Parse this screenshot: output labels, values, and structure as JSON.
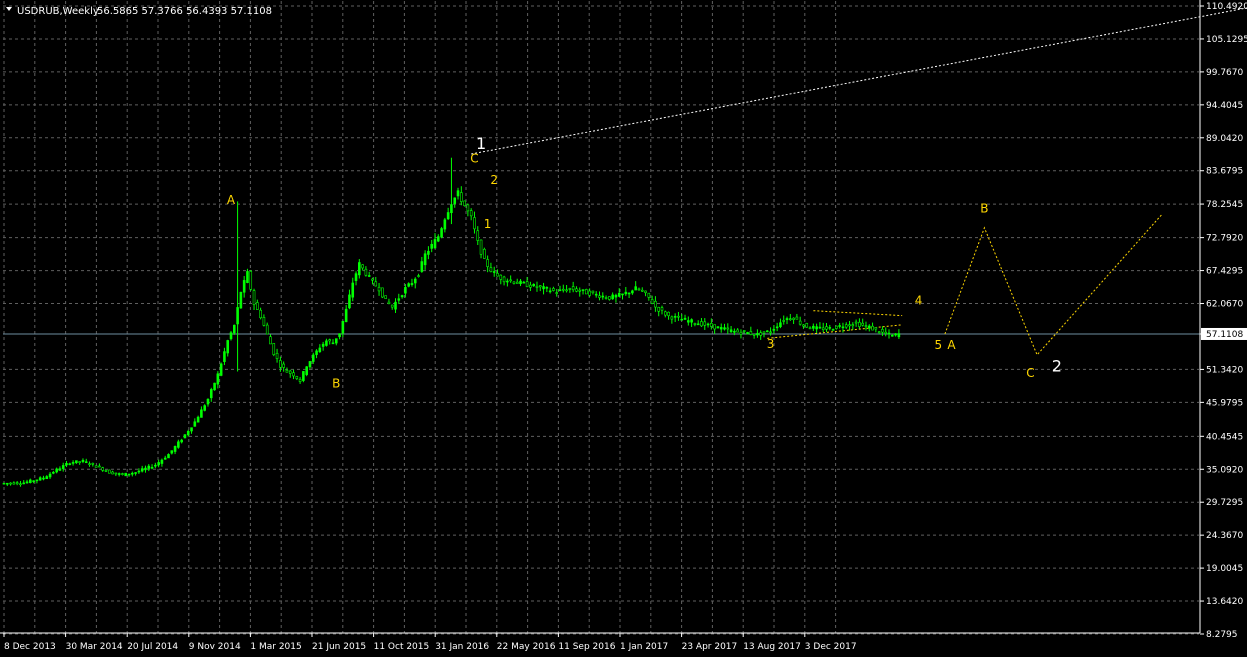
{
  "header": {
    "symbol": "USDRUB,Weekly",
    "ohlc": "56.5865 57.3766 56.4393 57.1108"
  },
  "colors": {
    "background": "#000000",
    "grid": "#5f5f5f",
    "bull_candle": "#00ff00",
    "bear_candle": "#ffffff",
    "price_line": "#6e8ea0",
    "wave_labels": "#ffd700",
    "projection": "#ffd700",
    "trend_line": "#ffffff"
  },
  "chart_data": {
    "type": "candlestick",
    "symbol": "USDRUB",
    "timeframe": "Weekly",
    "ylim": [
      8.2795,
      110.492
    ],
    "y_ticks": [
      "110.4920",
      "105.1295",
      "99.7670",
      "94.4045",
      "89.0420",
      "83.6795",
      "78.2545",
      "72.7920",
      "67.4295",
      "62.0670",
      "57.1108",
      "51.3420",
      "45.9795",
      "40.4545",
      "35.0920",
      "29.7295",
      "24.3670",
      "19.0045",
      "13.6420",
      "8.2795"
    ],
    "current_price": 57.1108,
    "x_ticks": [
      "8 Dec 2013",
      "30 Mar 2014",
      "20 Jul 2014",
      "9 Nov 2014",
      "1 Mar 2015",
      "21 Jun 2015",
      "11 Oct 2015",
      "31 Jan 2016",
      "22 May 2016",
      "11 Sep 2016",
      "1 Jan 2017",
      "23 Apr 2017",
      "13 Aug 2017",
      "3 Dec 2017"
    ],
    "grid": true,
    "price_path": [
      [
        0,
        32.8
      ],
      [
        6,
        32.9
      ],
      [
        12,
        33.7
      ],
      [
        16,
        35.0
      ],
      [
        20,
        36.2
      ],
      [
        24,
        36.4
      ],
      [
        28,
        35.6
      ],
      [
        32,
        34.6
      ],
      [
        36,
        34.2
      ],
      [
        40,
        34.6
      ],
      [
        46,
        35.8
      ],
      [
        50,
        37.5
      ],
      [
        54,
        40.0
      ],
      [
        58,
        42.8
      ],
      [
        62,
        46.5
      ],
      [
        65,
        50.5
      ],
      [
        68,
        56.0
      ],
      [
        70,
        58.5
      ],
      [
        72,
        64.0
      ],
      [
        74,
        67.0
      ],
      [
        76,
        62.0
      ],
      [
        78,
        60.0
      ],
      [
        80,
        57.0
      ],
      [
        82,
        54.0
      ],
      [
        84,
        52.0
      ],
      [
        86,
        51.0
      ],
      [
        88,
        50.5
      ],
      [
        90,
        49.5
      ],
      [
        92,
        52.0
      ],
      [
        94,
        53.5
      ],
      [
        96,
        55.0
      ],
      [
        98,
        56.0
      ],
      [
        100,
        55.7
      ],
      [
        102,
        57.3
      ],
      [
        104,
        61.0
      ],
      [
        106,
        65.5
      ],
      [
        108,
        68.5
      ],
      [
        110,
        67.0
      ],
      [
        112,
        65.5
      ],
      [
        114,
        64.5
      ],
      [
        116,
        62.5
      ],
      [
        118,
        61.5
      ],
      [
        120,
        63.0
      ],
      [
        122,
        64.5
      ],
      [
        124,
        65.5
      ],
      [
        126,
        67.0
      ],
      [
        128,
        70.0
      ],
      [
        130,
        71.5
      ],
      [
        132,
        73.0
      ],
      [
        134,
        76.0
      ],
      [
        136,
        78.5
      ],
      [
        138,
        80.0
      ],
      [
        140,
        78.0
      ],
      [
        142,
        76.0
      ],
      [
        144,
        72.0
      ],
      [
        146,
        69.0
      ],
      [
        148,
        67.5
      ],
      [
        150,
        66.5
      ],
      [
        152,
        66.0
      ],
      [
        156,
        65.5
      ],
      [
        160,
        65.0
      ],
      [
        164,
        64.5
      ],
      [
        168,
        64.0
      ],
      [
        172,
        64.5
      ],
      [
        176,
        64.0
      ],
      [
        180,
        63.5
      ],
      [
        184,
        63.0
      ],
      [
        188,
        63.5
      ],
      [
        192,
        64.5
      ],
      [
        194,
        64.0
      ],
      [
        196,
        63.0
      ],
      [
        198,
        61.5
      ],
      [
        202,
        60.0
      ],
      [
        206,
        59.5
      ],
      [
        210,
        59.0
      ],
      [
        214,
        58.5
      ],
      [
        218,
        58.0
      ],
      [
        222,
        57.5
      ],
      [
        226,
        57.3
      ],
      [
        229,
        57.0
      ],
      [
        233,
        57.6
      ],
      [
        237,
        59.5
      ],
      [
        240,
        59.8
      ],
      [
        243,
        58.5
      ],
      [
        247,
        58.0
      ],
      [
        251,
        58.0
      ],
      [
        255,
        58.5
      ],
      [
        259,
        58.8
      ],
      [
        263,
        58.2
      ],
      [
        267,
        57.3
      ],
      [
        270,
        56.8
      ],
      [
        272,
        57.1
      ]
    ],
    "spikes": [
      {
        "x_index": 71,
        "high": 78.7,
        "low": 51.0
      },
      {
        "x_index": 136,
        "high": 85.8,
        "low": 75.0
      }
    ],
    "wave_labels": [
      {
        "text": "A",
        "color": "yellow",
        "x_index": 69,
        "y": 78.3,
        "size": "small"
      },
      {
        "text": "B",
        "color": "yellow",
        "x_index": 101,
        "y": 48.4,
        "size": "small"
      },
      {
        "text": "C",
        "color": "yellow",
        "x_index": 143,
        "y": 85.0,
        "size": "small"
      },
      {
        "text": "1",
        "color": "white",
        "x_index": 145,
        "y": 87.2,
        "size": "large"
      },
      {
        "text": "2",
        "color": "yellow",
        "x_index": 149,
        "y": 81.5,
        "size": "small"
      },
      {
        "text": "1",
        "color": "yellow",
        "x_index": 147,
        "y": 74.4,
        "size": "small"
      },
      {
        "text": "3",
        "color": "yellow",
        "x_index": 233,
        "y": 54.8,
        "size": "small"
      },
      {
        "text": "4",
        "color": "yellow",
        "x_index": 278,
        "y": 61.9,
        "size": "small"
      },
      {
        "text": "5",
        "color": "yellow",
        "x_index": 284,
        "y": 54.7,
        "size": "small"
      },
      {
        "text": "A",
        "color": "yellow",
        "x_index": 288,
        "y": 54.7,
        "size": "small"
      },
      {
        "text": "B",
        "color": "yellow",
        "x_index": 298,
        "y": 76.9,
        "size": "small"
      },
      {
        "text": "C",
        "color": "yellow",
        "x_index": 312,
        "y": 50.1,
        "size": "small"
      },
      {
        "text": "2",
        "color": "white",
        "x_index": 320,
        "y": 51.0,
        "size": "large"
      }
    ],
    "wedge_upper": [
      [
        246,
        60.9
      ],
      [
        273,
        60.1
      ]
    ],
    "wedge_lower": [
      [
        232,
        56.4
      ],
      [
        273,
        58.6
      ]
    ],
    "projection": [
      [
        286,
        57.1
      ],
      [
        298,
        74.4
      ],
      [
        314,
        53.7
      ],
      [
        352,
        76.6
      ]
    ],
    "trend_line": [
      [
        142,
        86.4
      ],
      [
        379,
        110.3
      ]
    ]
  }
}
